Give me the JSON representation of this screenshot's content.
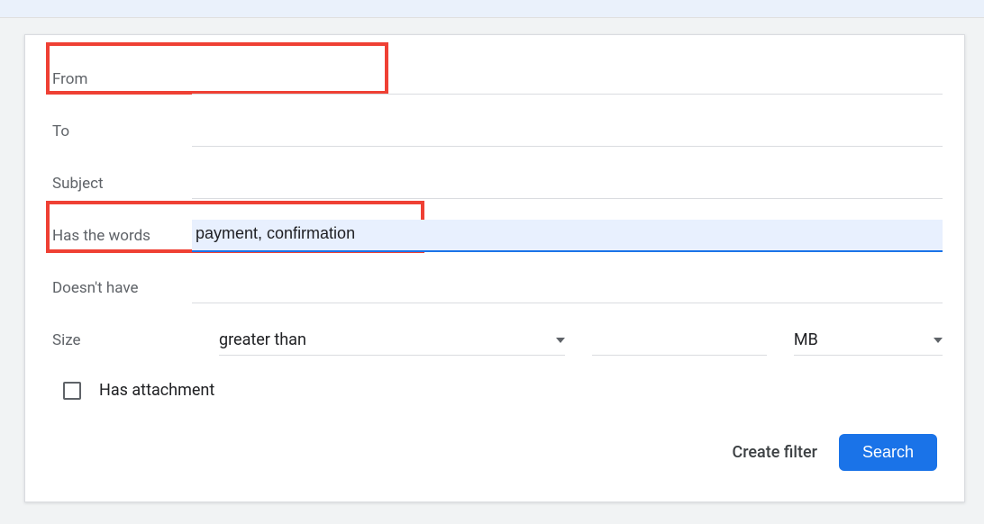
{
  "labels": {
    "from": "From",
    "to": "To",
    "subject": "Subject",
    "has_words": "Has the words",
    "doesnt_have": "Doesn't have",
    "size": "Size",
    "has_attachment": "Has attachment"
  },
  "values": {
    "from": "",
    "to": "",
    "subject": "",
    "has_words": "payment, confirmation",
    "doesnt_have": "",
    "size_op": "greater than",
    "size_amount": "",
    "size_unit": "MB"
  },
  "actions": {
    "create_filter": "Create filter",
    "search": "Search"
  }
}
